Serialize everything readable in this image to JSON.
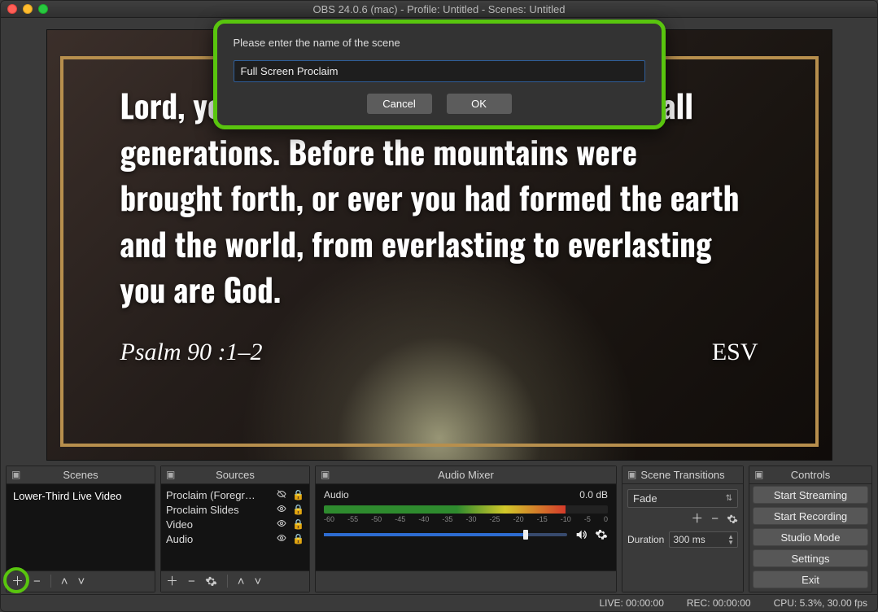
{
  "window": {
    "title": "OBS 24.0.6 (mac) - Profile: Untitled - Scenes: Untitled"
  },
  "dialog": {
    "prompt": "Please enter the name of the scene",
    "value": "Full Screen Proclaim",
    "cancel": "Cancel",
    "ok": "OK"
  },
  "preview": {
    "text_line1": "Lord, you have been our dwelling place in all",
    "text_line2": "generations. Before the mountains were",
    "text_line3": "brought forth, or ever you had formed the earth",
    "text_line4": "and the world, from everlasting to everlasting",
    "text_line5": "you are God.",
    "citation": "Psalm 90 :1–2",
    "version": "ESV"
  },
  "panels": {
    "scenes": {
      "title": "Scenes",
      "items": [
        "Lower-Third Live Video"
      ]
    },
    "sources": {
      "title": "Sources",
      "items": [
        {
          "label": "Proclaim (Foregroun",
          "visible": false,
          "locked": true
        },
        {
          "label": "Proclaim Slides",
          "visible": true,
          "locked": true
        },
        {
          "label": "Video",
          "visible": true,
          "locked": true
        },
        {
          "label": "Audio",
          "visible": true,
          "locked": true
        }
      ]
    },
    "mixer": {
      "title": "Audio Mixer",
      "track_label": "Audio",
      "level_db": "0.0 dB",
      "scale": [
        "-60",
        "-55",
        "-50",
        "-45",
        "-40",
        "-35",
        "-30",
        "-25",
        "-20",
        "-15",
        "-10",
        "-5",
        "0"
      ]
    },
    "transitions": {
      "title": "Scene Transitions",
      "selected": "Fade",
      "duration_label": "Duration",
      "duration_value": "300 ms"
    },
    "controls": {
      "title": "Controls",
      "buttons": [
        "Start Streaming",
        "Start Recording",
        "Studio Mode",
        "Settings",
        "Exit"
      ]
    }
  },
  "status": {
    "live": "LIVE: 00:00:00",
    "rec": "REC: 00:00:00",
    "cpu": "CPU: 5.3%, 30.00 fps"
  }
}
